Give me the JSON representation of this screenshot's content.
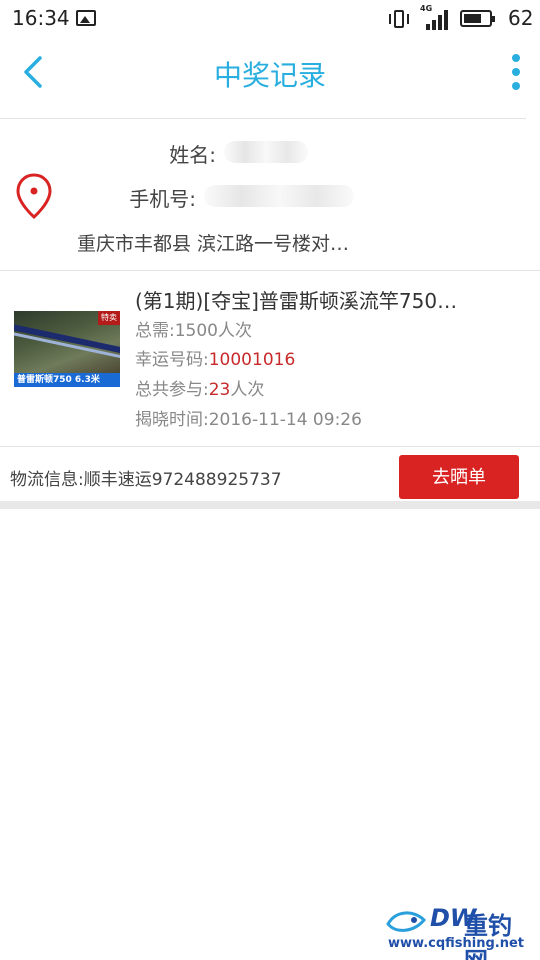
{
  "status_bar": {
    "time": "16:34",
    "battery": "62",
    "network": "4G"
  },
  "header": {
    "title": "中奖记录"
  },
  "address": {
    "name_label": "姓名:",
    "phone_label": "手机号:",
    "address_text": "重庆市丰都县 滨江路一号楼对…"
  },
  "product": {
    "title": "(第1期)[夺宝]普雷斯顿溪流竿750…",
    "thumb_tag": "特卖",
    "thumb_caption": "普雷斯顿750 6.3米",
    "total_label": "总需:",
    "total_value": "1500人次",
    "lucky_label": "幸运号码:",
    "lucky_value": "10001016",
    "joined_label": "总共参与:",
    "joined_value": "23",
    "joined_unit": "人次",
    "reveal_label": "揭晓时间:",
    "reveal_value": "2016-11-14 09:26"
  },
  "logistics": {
    "text": "物流信息:顺丰速运972488925737",
    "button_label": "去晒单"
  },
  "watermark": {
    "brand": "DW",
    "name": "重钓网",
    "url": "www.cqfishing.net"
  },
  "colors": {
    "accent": "#29aee0",
    "danger": "#d92323",
    "lucky": "#c82a2a"
  }
}
